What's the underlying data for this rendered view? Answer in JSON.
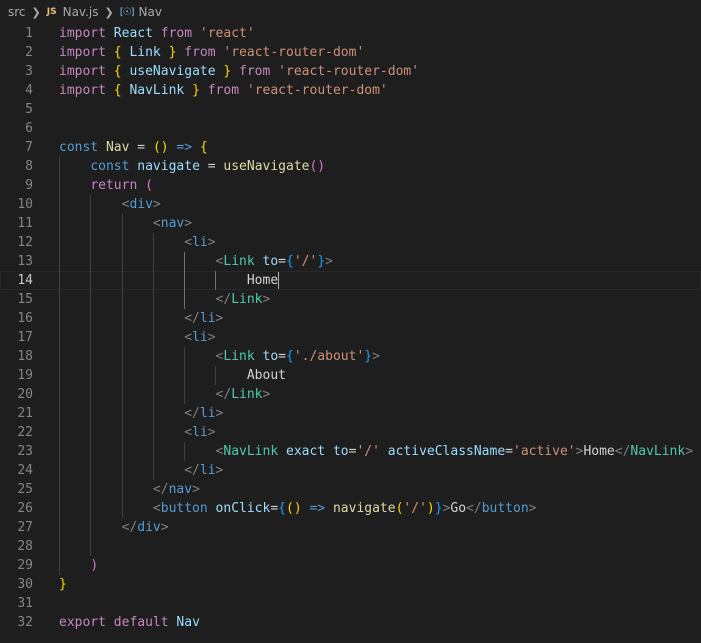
{
  "breadcrumb": {
    "items": [
      "src",
      "Nav.js",
      "Nav"
    ],
    "file_icon": "js-file-icon",
    "symbol_icon": "symbol-component-icon"
  },
  "editor": {
    "current_line": 14,
    "lines": [
      {
        "n": "1",
        "tokens": [
          [
            "kw",
            "import"
          ],
          [
            "txt",
            " "
          ],
          [
            "var",
            "React"
          ],
          [
            "txt",
            " "
          ],
          [
            "kw",
            "from"
          ],
          [
            "txt",
            " "
          ],
          [
            "str",
            "'react'"
          ]
        ]
      },
      {
        "n": "2",
        "tokens": [
          [
            "kw",
            "import"
          ],
          [
            "txt",
            " "
          ],
          [
            "br1",
            "{"
          ],
          [
            "txt",
            " "
          ],
          [
            "var",
            "Link"
          ],
          [
            "txt",
            " "
          ],
          [
            "br1",
            "}"
          ],
          [
            "txt",
            " "
          ],
          [
            "kw",
            "from"
          ],
          [
            "txt",
            " "
          ],
          [
            "str",
            "'react-router-dom'"
          ]
        ]
      },
      {
        "n": "3",
        "tokens": [
          [
            "kw",
            "import"
          ],
          [
            "txt",
            " "
          ],
          [
            "br1",
            "{"
          ],
          [
            "txt",
            " "
          ],
          [
            "var",
            "useNavigate"
          ],
          [
            "txt",
            " "
          ],
          [
            "br1",
            "}"
          ],
          [
            "txt",
            " "
          ],
          [
            "kw",
            "from"
          ],
          [
            "txt",
            " "
          ],
          [
            "str",
            "'react-router-dom'"
          ]
        ]
      },
      {
        "n": "4",
        "tokens": [
          [
            "kw",
            "import"
          ],
          [
            "txt",
            " "
          ],
          [
            "br1",
            "{"
          ],
          [
            "txt",
            " "
          ],
          [
            "var",
            "NavLink"
          ],
          [
            "txt",
            " "
          ],
          [
            "br1",
            "}"
          ],
          [
            "txt",
            " "
          ],
          [
            "kw",
            "from"
          ],
          [
            "txt",
            " "
          ],
          [
            "str",
            "'react-router-dom'"
          ]
        ]
      },
      {
        "n": "5",
        "tokens": []
      },
      {
        "n": "6",
        "tokens": []
      },
      {
        "n": "7",
        "tokens": [
          [
            "st",
            "const"
          ],
          [
            "txt",
            " "
          ],
          [
            "fn",
            "Nav"
          ],
          [
            "txt",
            " = "
          ],
          [
            "br1",
            "()"
          ],
          [
            "txt",
            " "
          ],
          [
            "st",
            "=>"
          ],
          [
            "txt",
            " "
          ],
          [
            "br1",
            "{"
          ]
        ]
      },
      {
        "n": "8",
        "tokens": [
          [
            "txt",
            "    "
          ],
          [
            "st",
            "const"
          ],
          [
            "txt",
            " "
          ],
          [
            "var",
            "navigate"
          ],
          [
            "txt",
            " = "
          ],
          [
            "fn",
            "useNavigate"
          ],
          [
            "br2",
            "()"
          ]
        ]
      },
      {
        "n": "9",
        "tokens": [
          [
            "txt",
            "    "
          ],
          [
            "kw",
            "return"
          ],
          [
            "txt",
            " "
          ],
          [
            "br2",
            "("
          ]
        ]
      },
      {
        "n": "10",
        "tokens": [
          [
            "txt",
            "        "
          ],
          [
            "punc",
            "<"
          ],
          [
            "tag",
            "div"
          ],
          [
            "punc",
            ">"
          ]
        ]
      },
      {
        "n": "11",
        "tokens": [
          [
            "txt",
            "            "
          ],
          [
            "punc",
            "<"
          ],
          [
            "tag",
            "nav"
          ],
          [
            "punc",
            ">"
          ]
        ]
      },
      {
        "n": "12",
        "tokens": [
          [
            "txt",
            "                "
          ],
          [
            "punc",
            "<"
          ],
          [
            "tag",
            "li"
          ],
          [
            "punc",
            ">"
          ]
        ]
      },
      {
        "n": "13",
        "tokens": [
          [
            "txt",
            "                    "
          ],
          [
            "punc",
            "<"
          ],
          [
            "comp",
            "Link"
          ],
          [
            "txt",
            " "
          ],
          [
            "attr",
            "to"
          ],
          [
            "txt",
            "="
          ],
          [
            "br3",
            "{"
          ],
          [
            "str",
            "'/'"
          ],
          [
            "br3",
            "}"
          ],
          [
            "punc",
            ">"
          ]
        ]
      },
      {
        "n": "14",
        "tokens": [
          [
            "txt",
            "                        "
          ],
          [
            "txt",
            "Home"
          ]
        ]
      },
      {
        "n": "15",
        "tokens": [
          [
            "txt",
            "                    "
          ],
          [
            "punc",
            "</"
          ],
          [
            "comp",
            "Link"
          ],
          [
            "punc",
            ">"
          ]
        ]
      },
      {
        "n": "16",
        "tokens": [
          [
            "txt",
            "                "
          ],
          [
            "punc",
            "</"
          ],
          [
            "tag",
            "li"
          ],
          [
            "punc",
            ">"
          ]
        ]
      },
      {
        "n": "17",
        "tokens": [
          [
            "txt",
            "                "
          ],
          [
            "punc",
            "<"
          ],
          [
            "tag",
            "li"
          ],
          [
            "punc",
            ">"
          ]
        ]
      },
      {
        "n": "18",
        "tokens": [
          [
            "txt",
            "                    "
          ],
          [
            "punc",
            "<"
          ],
          [
            "comp",
            "Link"
          ],
          [
            "txt",
            " "
          ],
          [
            "attr",
            "to"
          ],
          [
            "txt",
            "="
          ],
          [
            "br3",
            "{"
          ],
          [
            "str",
            "'./about'"
          ],
          [
            "br3",
            "}"
          ],
          [
            "punc",
            ">"
          ]
        ]
      },
      {
        "n": "19",
        "tokens": [
          [
            "txt",
            "                        "
          ],
          [
            "txt",
            "About"
          ]
        ]
      },
      {
        "n": "20",
        "tokens": [
          [
            "txt",
            "                    "
          ],
          [
            "punc",
            "</"
          ],
          [
            "comp",
            "Link"
          ],
          [
            "punc",
            ">"
          ]
        ]
      },
      {
        "n": "21",
        "tokens": [
          [
            "txt",
            "                "
          ],
          [
            "punc",
            "</"
          ],
          [
            "tag",
            "li"
          ],
          [
            "punc",
            ">"
          ]
        ]
      },
      {
        "n": "22",
        "tokens": [
          [
            "txt",
            "                "
          ],
          [
            "punc",
            "<"
          ],
          [
            "tag",
            "li"
          ],
          [
            "punc",
            ">"
          ]
        ]
      },
      {
        "n": "23",
        "tokens": [
          [
            "txt",
            "                    "
          ],
          [
            "punc",
            "<"
          ],
          [
            "comp",
            "NavLink"
          ],
          [
            "txt",
            " "
          ],
          [
            "attr",
            "exact"
          ],
          [
            "txt",
            " "
          ],
          [
            "attr",
            "to"
          ],
          [
            "txt",
            "="
          ],
          [
            "str",
            "'/'"
          ],
          [
            "txt",
            " "
          ],
          [
            "attr",
            "activeClassName"
          ],
          [
            "txt",
            "="
          ],
          [
            "str",
            "'active'"
          ],
          [
            "punc",
            ">"
          ],
          [
            "txt",
            "Home"
          ],
          [
            "punc",
            "</"
          ],
          [
            "comp",
            "NavLink"
          ],
          [
            "punc",
            ">"
          ]
        ]
      },
      {
        "n": "24",
        "tokens": [
          [
            "txt",
            "                "
          ],
          [
            "punc",
            "</"
          ],
          [
            "tag",
            "li"
          ],
          [
            "punc",
            ">"
          ]
        ]
      },
      {
        "n": "25",
        "tokens": [
          [
            "txt",
            "            "
          ],
          [
            "punc",
            "</"
          ],
          [
            "tag",
            "nav"
          ],
          [
            "punc",
            ">"
          ]
        ]
      },
      {
        "n": "26",
        "tokens": [
          [
            "txt",
            "            "
          ],
          [
            "punc",
            "<"
          ],
          [
            "tag",
            "button"
          ],
          [
            "txt",
            " "
          ],
          [
            "attr",
            "onClick"
          ],
          [
            "txt",
            "="
          ],
          [
            "br3",
            "{"
          ],
          [
            "br1",
            "()"
          ],
          [
            "txt",
            " "
          ],
          [
            "st",
            "=>"
          ],
          [
            "txt",
            " "
          ],
          [
            "fn",
            "navigate"
          ],
          [
            "br1",
            "("
          ],
          [
            "str",
            "'/'"
          ],
          [
            "br1",
            ")"
          ],
          [
            "br3",
            "}"
          ],
          [
            "punc",
            ">"
          ],
          [
            "txt",
            "Go"
          ],
          [
            "punc",
            "</"
          ],
          [
            "tag",
            "button"
          ],
          [
            "punc",
            ">"
          ]
        ]
      },
      {
        "n": "27",
        "tokens": [
          [
            "txt",
            "        "
          ],
          [
            "punc",
            "</"
          ],
          [
            "tag",
            "div"
          ],
          [
            "punc",
            ">"
          ]
        ]
      },
      {
        "n": "28",
        "tokens": []
      },
      {
        "n": "29",
        "tokens": [
          [
            "txt",
            "    "
          ],
          [
            "br2",
            ")"
          ]
        ]
      },
      {
        "n": "30",
        "tokens": [
          [
            "br1",
            "}"
          ]
        ]
      },
      {
        "n": "31",
        "tokens": []
      },
      {
        "n": "32",
        "tokens": [
          [
            "kw",
            "export"
          ],
          [
            "txt",
            " "
          ],
          [
            "kw",
            "default"
          ],
          [
            "txt",
            " "
          ],
          [
            "var",
            "Nav"
          ]
        ]
      }
    ]
  }
}
